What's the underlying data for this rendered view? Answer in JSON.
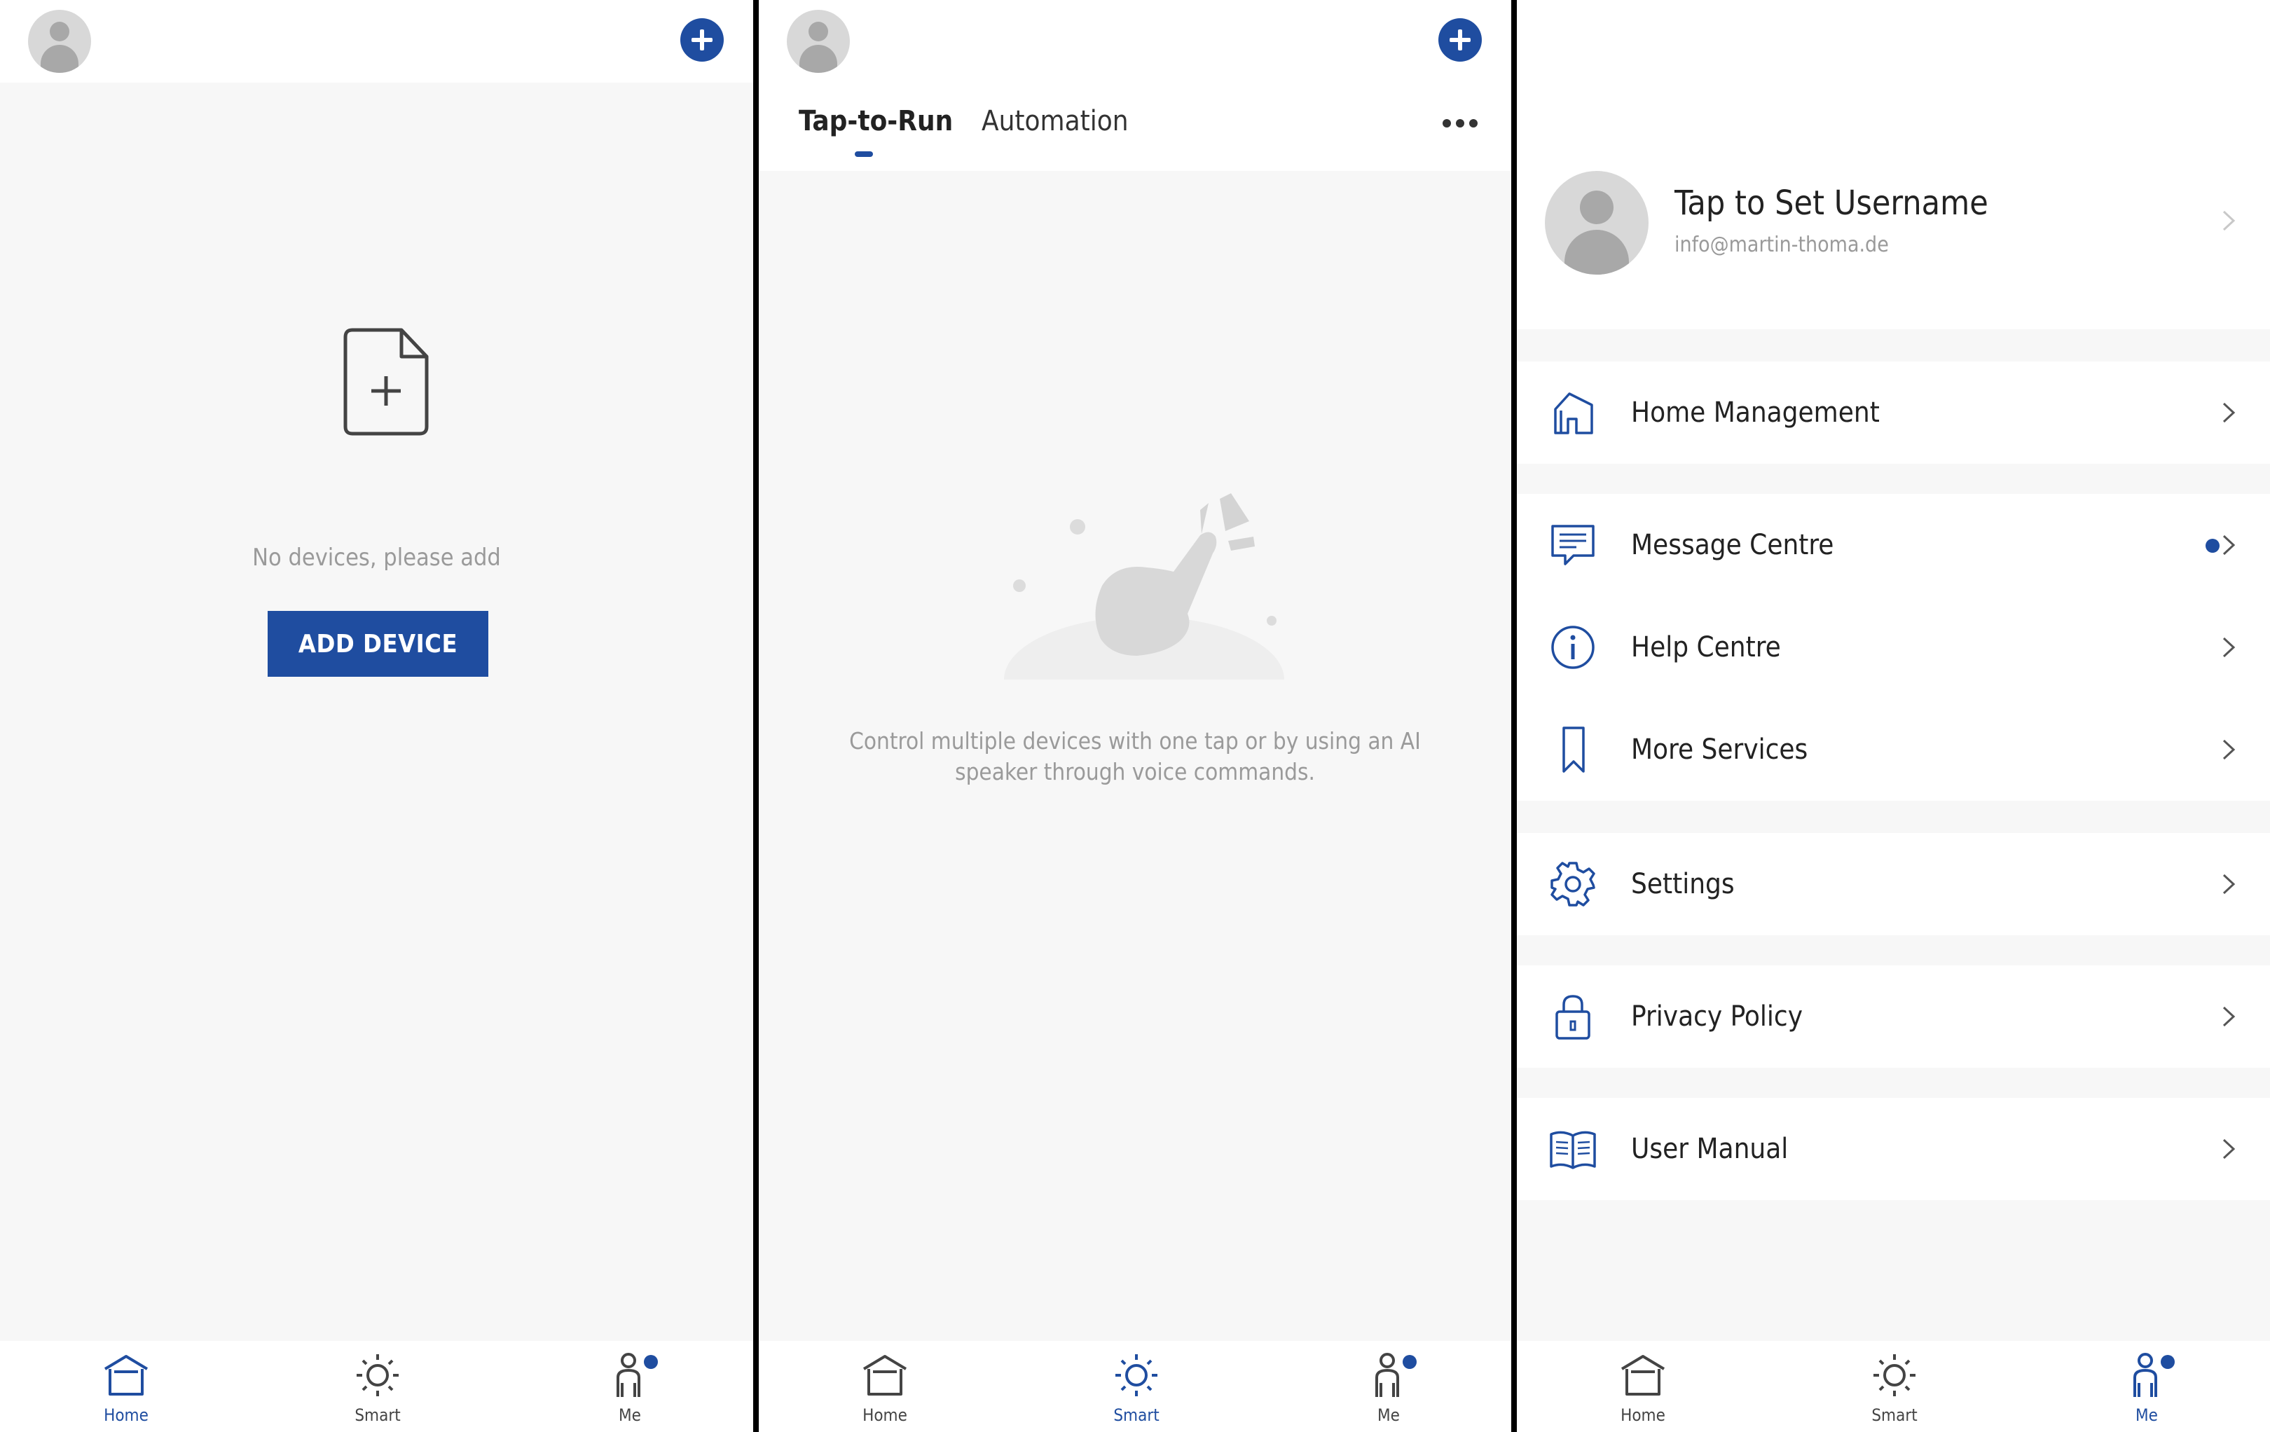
{
  "colors": {
    "accent": "#1f4da0",
    "muted_text": "#9a9a9a",
    "background": "#f7f7f7"
  },
  "home": {
    "add_icon": "plus-circle-icon",
    "empty_icon": "add-document-icon",
    "empty_text": "No devices, please add",
    "add_device_label": "ADD DEVICE"
  },
  "smart": {
    "tabs": [
      {
        "label": "Tap-to-Run",
        "active": true
      },
      {
        "label": "Automation",
        "active": false
      }
    ],
    "more_icon": "more-dots-icon",
    "empty_text": "Control multiple devices with one tap or by using an AI speaker through voice commands."
  },
  "me": {
    "username": "Tap to Set Username",
    "email": "info@martin-thoma.de",
    "menu": [
      {
        "label": "Home Management",
        "icon": "house-icon"
      },
      {
        "label": "Message Centre",
        "icon": "message-icon",
        "badge": true
      },
      {
        "label": "Help Centre",
        "icon": "info-icon"
      },
      {
        "label": "More Services",
        "icon": "bookmark-icon"
      },
      {
        "label": "Settings",
        "icon": "gear-icon"
      },
      {
        "label": "Privacy Policy",
        "icon": "lock-icon"
      },
      {
        "label": "User Manual",
        "icon": "book-icon"
      }
    ]
  },
  "nav": {
    "items": [
      {
        "label": "Home",
        "icon": "home-icon"
      },
      {
        "label": "Smart",
        "icon": "sun-icon"
      },
      {
        "label": "Me",
        "icon": "person-icon"
      }
    ],
    "active_by_screen": [
      "Home",
      "Smart",
      "Me"
    ]
  }
}
